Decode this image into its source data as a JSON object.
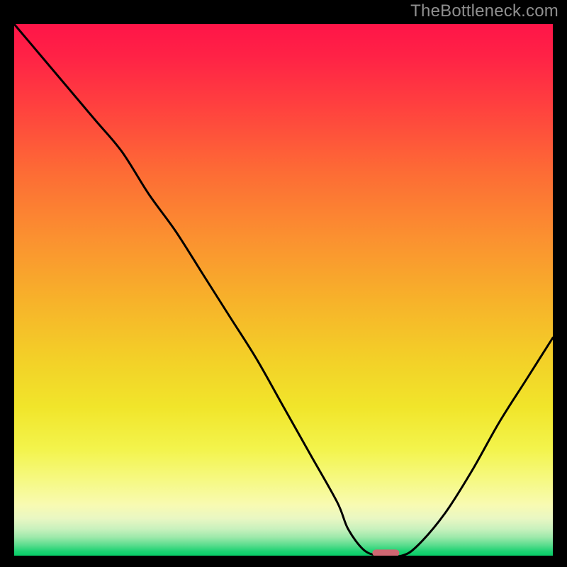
{
  "watermark": "TheBottleneck.com",
  "chart_data": {
    "type": "line",
    "title": "",
    "xlabel": "",
    "ylabel": "",
    "xlim": [
      0,
      100
    ],
    "ylim": [
      0,
      100
    ],
    "x": [
      0,
      5,
      10,
      15,
      20,
      25,
      30,
      35,
      40,
      45,
      50,
      55,
      60,
      62,
      65,
      68,
      72,
      75,
      80,
      85,
      90,
      95,
      100
    ],
    "values": [
      100,
      94,
      88,
      82,
      76,
      68,
      61,
      53,
      45,
      37,
      28,
      19,
      10,
      5,
      1,
      0,
      0,
      2,
      8,
      16,
      25,
      33,
      41
    ],
    "marker": {
      "x": 69,
      "y": 0.5,
      "width": 5,
      "height": 1.3,
      "color": "#cf6672"
    },
    "gradient_stops": [
      {
        "offset": 0.0,
        "color": "#ff1548"
      },
      {
        "offset": 0.06,
        "color": "#ff2246"
      },
      {
        "offset": 0.15,
        "color": "#ff3f3f"
      },
      {
        "offset": 0.28,
        "color": "#fd6c35"
      },
      {
        "offset": 0.4,
        "color": "#fb9030"
      },
      {
        "offset": 0.52,
        "color": "#f7b22a"
      },
      {
        "offset": 0.63,
        "color": "#f3d028"
      },
      {
        "offset": 0.72,
        "color": "#f1e52a"
      },
      {
        "offset": 0.8,
        "color": "#f3f44c"
      },
      {
        "offset": 0.86,
        "color": "#f6f985"
      },
      {
        "offset": 0.905,
        "color": "#f8fab2"
      },
      {
        "offset": 0.93,
        "color": "#e9f7c3"
      },
      {
        "offset": 0.95,
        "color": "#c8f1bd"
      },
      {
        "offset": 0.965,
        "color": "#9ee9ab"
      },
      {
        "offset": 0.98,
        "color": "#5bdd8e"
      },
      {
        "offset": 0.992,
        "color": "#1cd272"
      },
      {
        "offset": 1.0,
        "color": "#07cd67"
      }
    ]
  }
}
